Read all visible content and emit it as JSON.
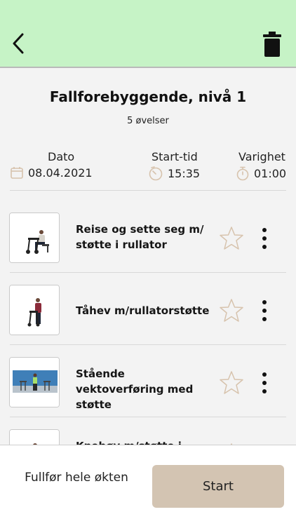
{
  "header": {
    "back_icon": "chevron-left-icon",
    "delete_icon": "trash-icon",
    "background_color": "#c6f3c6"
  },
  "session": {
    "title": "Fallforebyggende, nivå 1",
    "subtitle": "5 øvelser"
  },
  "stats": {
    "date": {
      "label": "Dato",
      "value": "08.04.2021",
      "icon": "calendar-icon"
    },
    "start_time": {
      "label": "Start-tid",
      "value": "15:35",
      "icon": "clock-icon"
    },
    "duration": {
      "label": "Varighet",
      "value": "01:00",
      "icon": "stopwatch-icon"
    },
    "icon_color": "#d7c3ad"
  },
  "exercises": [
    {
      "title": "Reise og sette seg m/ støtte i rullator",
      "favorite": false
    },
    {
      "title": "Tåhev m/rullatorstøtte",
      "favorite": false
    },
    {
      "title": "Stående vektoverføring med støtte",
      "favorite": false
    },
    {
      "title": "Knebøy m/støtte i",
      "favorite": false
    }
  ],
  "footer": {
    "finish_label": "Fullfør hele økten",
    "start_label": "Start",
    "start_color": "#d3c4b2"
  }
}
